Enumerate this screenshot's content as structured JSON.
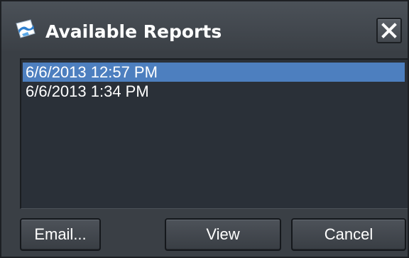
{
  "window": {
    "title": "Available Reports",
    "close_icon": "close-icon",
    "app_icon": "reports-app-icon"
  },
  "reports": {
    "items": [
      {
        "label": "6/6/2013 12:57 PM",
        "selected": true
      },
      {
        "label": "6/6/2013 1:34 PM",
        "selected": false
      }
    ]
  },
  "buttons": {
    "email_label": "Email...",
    "view_label": "View",
    "cancel_label": "Cancel"
  },
  "colors": {
    "dialog_background": "#3a3f45",
    "list_background": "#2a3038",
    "selection": "#4d7fbf",
    "text": "#ffffff"
  }
}
